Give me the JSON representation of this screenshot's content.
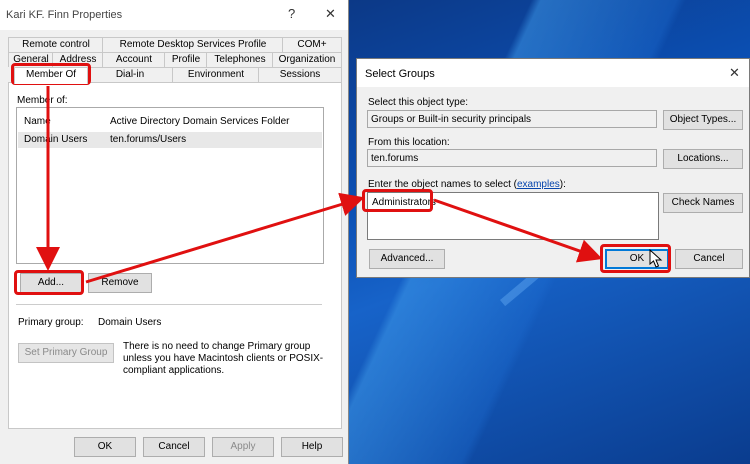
{
  "window": {
    "title": "Kari KF. Finn Properties",
    "help_glyph": "?",
    "close_glyph": "✕",
    "tabs_row1": [
      "Remote control",
      "Remote Desktop Services Profile",
      "COM+"
    ],
    "tabs_row2": [
      "General",
      "Address",
      "Account",
      "Profile",
      "Telephones",
      "Organization"
    ],
    "tabs_row3": [
      "Member Of",
      "Dial-in",
      "Environment",
      "Sessions"
    ],
    "member_of_label": "Member of:",
    "columns": [
      "Name",
      "Active Directory Domain Services Folder"
    ],
    "rows": [
      {
        "name": "Domain Users",
        "folder": "ten.forums/Users"
      }
    ],
    "add_label": "Add...",
    "remove_label": "Remove",
    "primary_group_label": "Primary group:",
    "primary_group_value": "Domain Users",
    "set_primary_label": "Set Primary Group",
    "info_text": "There is no need to change Primary group unless you have Macintosh clients or POSIX-compliant applications.",
    "ok_label": "OK",
    "cancel_label": "Cancel",
    "apply_label": "Apply",
    "help_label": "Help"
  },
  "dialog": {
    "title": "Select Groups",
    "close_glyph": "✕",
    "object_type_label": "Select this object type:",
    "object_type_value": "Groups or Built-in security principals",
    "object_types_button": "Object Types...",
    "location_label": "From this location:",
    "location_value": "ten.forums",
    "locations_button": "Locations...",
    "names_label_prefix": "Enter the object names to select (",
    "names_label_link": "examples",
    "names_label_suffix": "):",
    "names_value": "Administrators",
    "check_names_button": "Check Names",
    "advanced_button": "Advanced...",
    "ok_button": "OK",
    "cancel_button": "Cancel"
  },
  "colors": {
    "highlight": "#e01010",
    "accent_blue": "#0078d7"
  }
}
